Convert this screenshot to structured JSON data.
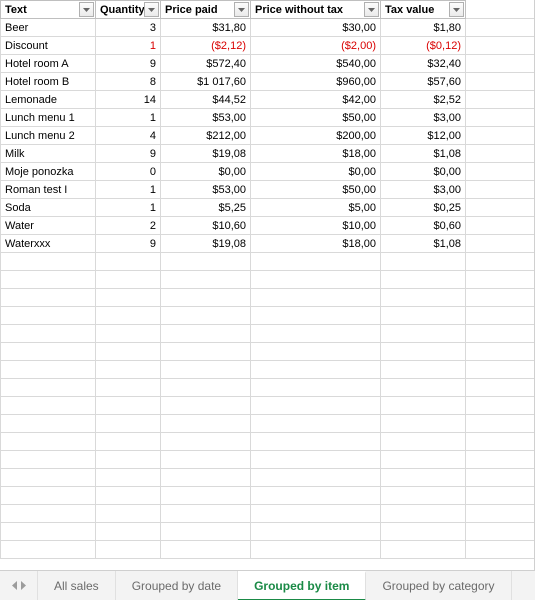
{
  "chart_data": {
    "type": "table",
    "title": "Grouped by item",
    "columns": [
      "Text",
      "Quantity",
      "Price paid",
      "Price without tax",
      "Tax value"
    ],
    "rows": [
      {
        "text": "Beer",
        "quantity": 3,
        "price_paid": "$31,80",
        "price_without_tax": "$30,00",
        "tax_value": "$1,80",
        "neg": false
      },
      {
        "text": "Discount",
        "quantity": 1,
        "price_paid": "($2,12)",
        "price_without_tax": "($2,00)",
        "tax_value": "($0,12)",
        "neg": true
      },
      {
        "text": "Hotel room A",
        "quantity": 9,
        "price_paid": "$572,40",
        "price_without_tax": "$540,00",
        "tax_value": "$32,40",
        "neg": false
      },
      {
        "text": "Hotel room B",
        "quantity": 8,
        "price_paid": "$1 017,60",
        "price_without_tax": "$960,00",
        "tax_value": "$57,60",
        "neg": false
      },
      {
        "text": "Lemonade",
        "quantity": 14,
        "price_paid": "$44,52",
        "price_without_tax": "$42,00",
        "tax_value": "$2,52",
        "neg": false
      },
      {
        "text": "Lunch menu 1",
        "quantity": 1,
        "price_paid": "$53,00",
        "price_without_tax": "$50,00",
        "tax_value": "$3,00",
        "neg": false
      },
      {
        "text": "Lunch menu 2",
        "quantity": 4,
        "price_paid": "$212,00",
        "price_without_tax": "$200,00",
        "tax_value": "$12,00",
        "neg": false
      },
      {
        "text": "Milk",
        "quantity": 9,
        "price_paid": "$19,08",
        "price_without_tax": "$18,00",
        "tax_value": "$1,08",
        "neg": false
      },
      {
        "text": "Moje ponozka",
        "quantity": 0,
        "price_paid": "$0,00",
        "price_without_tax": "$0,00",
        "tax_value": "$0,00",
        "neg": false
      },
      {
        "text": "Roman test I",
        "quantity": 1,
        "price_paid": "$53,00",
        "price_without_tax": "$50,00",
        "tax_value": "$3,00",
        "neg": false
      },
      {
        "text": "Soda",
        "quantity": 1,
        "price_paid": "$5,25",
        "price_without_tax": "$5,00",
        "tax_value": "$0,25",
        "neg": false
      },
      {
        "text": "Water",
        "quantity": 2,
        "price_paid": "$10,60",
        "price_without_tax": "$10,00",
        "tax_value": "$0,60",
        "neg": false
      },
      {
        "text": "Waterxxx",
        "quantity": 9,
        "price_paid": "$19,08",
        "price_without_tax": "$18,00",
        "tax_value": "$1,08",
        "neg": false
      }
    ]
  },
  "blank_rows": 17,
  "tabs": {
    "items": [
      "All sales",
      "Grouped by date",
      "Grouped by item",
      "Grouped by category"
    ],
    "active_index": 2
  }
}
